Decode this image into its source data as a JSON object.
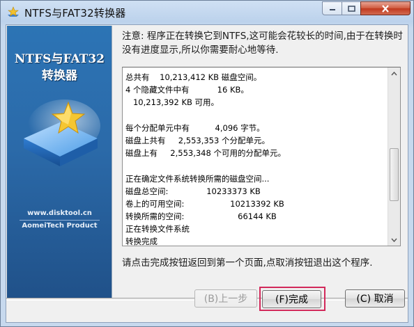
{
  "window": {
    "title": "NTFS与FAT32转换器"
  },
  "banner": {
    "title_line1": "NTFS与FAT32",
    "title_line2": "转换器",
    "url": "www.disktool.cn",
    "company": "AomeiTech Product"
  },
  "notice": {
    "text": "注意: 程序正在转换它到NTFS,这可能会花较长的时间,由于在转换时没有进度显示,所以你需要耐心地等待."
  },
  "log": {
    "lines": [
      "总共有    10,213,412 KB 磁盘空间。",
      "4 个隐藏文件中有           16 KB。",
      "   10,213,392 KB 可用。",
      "",
      "每个分配单元中有          4,096 字节。",
      "磁盘上共有     2,553,353 个分配单元。",
      "磁盘上有     2,553,348 个可用的分配单元。",
      "",
      "正在确定文件系统转换所需的磁盘空间...",
      "磁盘总空间:               10233373 KB",
      "卷上的可用空间:                  10213392 KB",
      "转换所需的空间:                     66144 KB",
      "正在转换文件系统",
      "转换完成"
    ]
  },
  "instruction": "请点击完成按钮返回到第一个页面,点取消按钮退出这个程序.",
  "buttons": {
    "back": "(B)上一步",
    "finish": "(F)完成",
    "cancel": "(C) 取消"
  },
  "colors": {
    "banner_blue": "#2b6aa9",
    "highlight": "#d2285a"
  }
}
